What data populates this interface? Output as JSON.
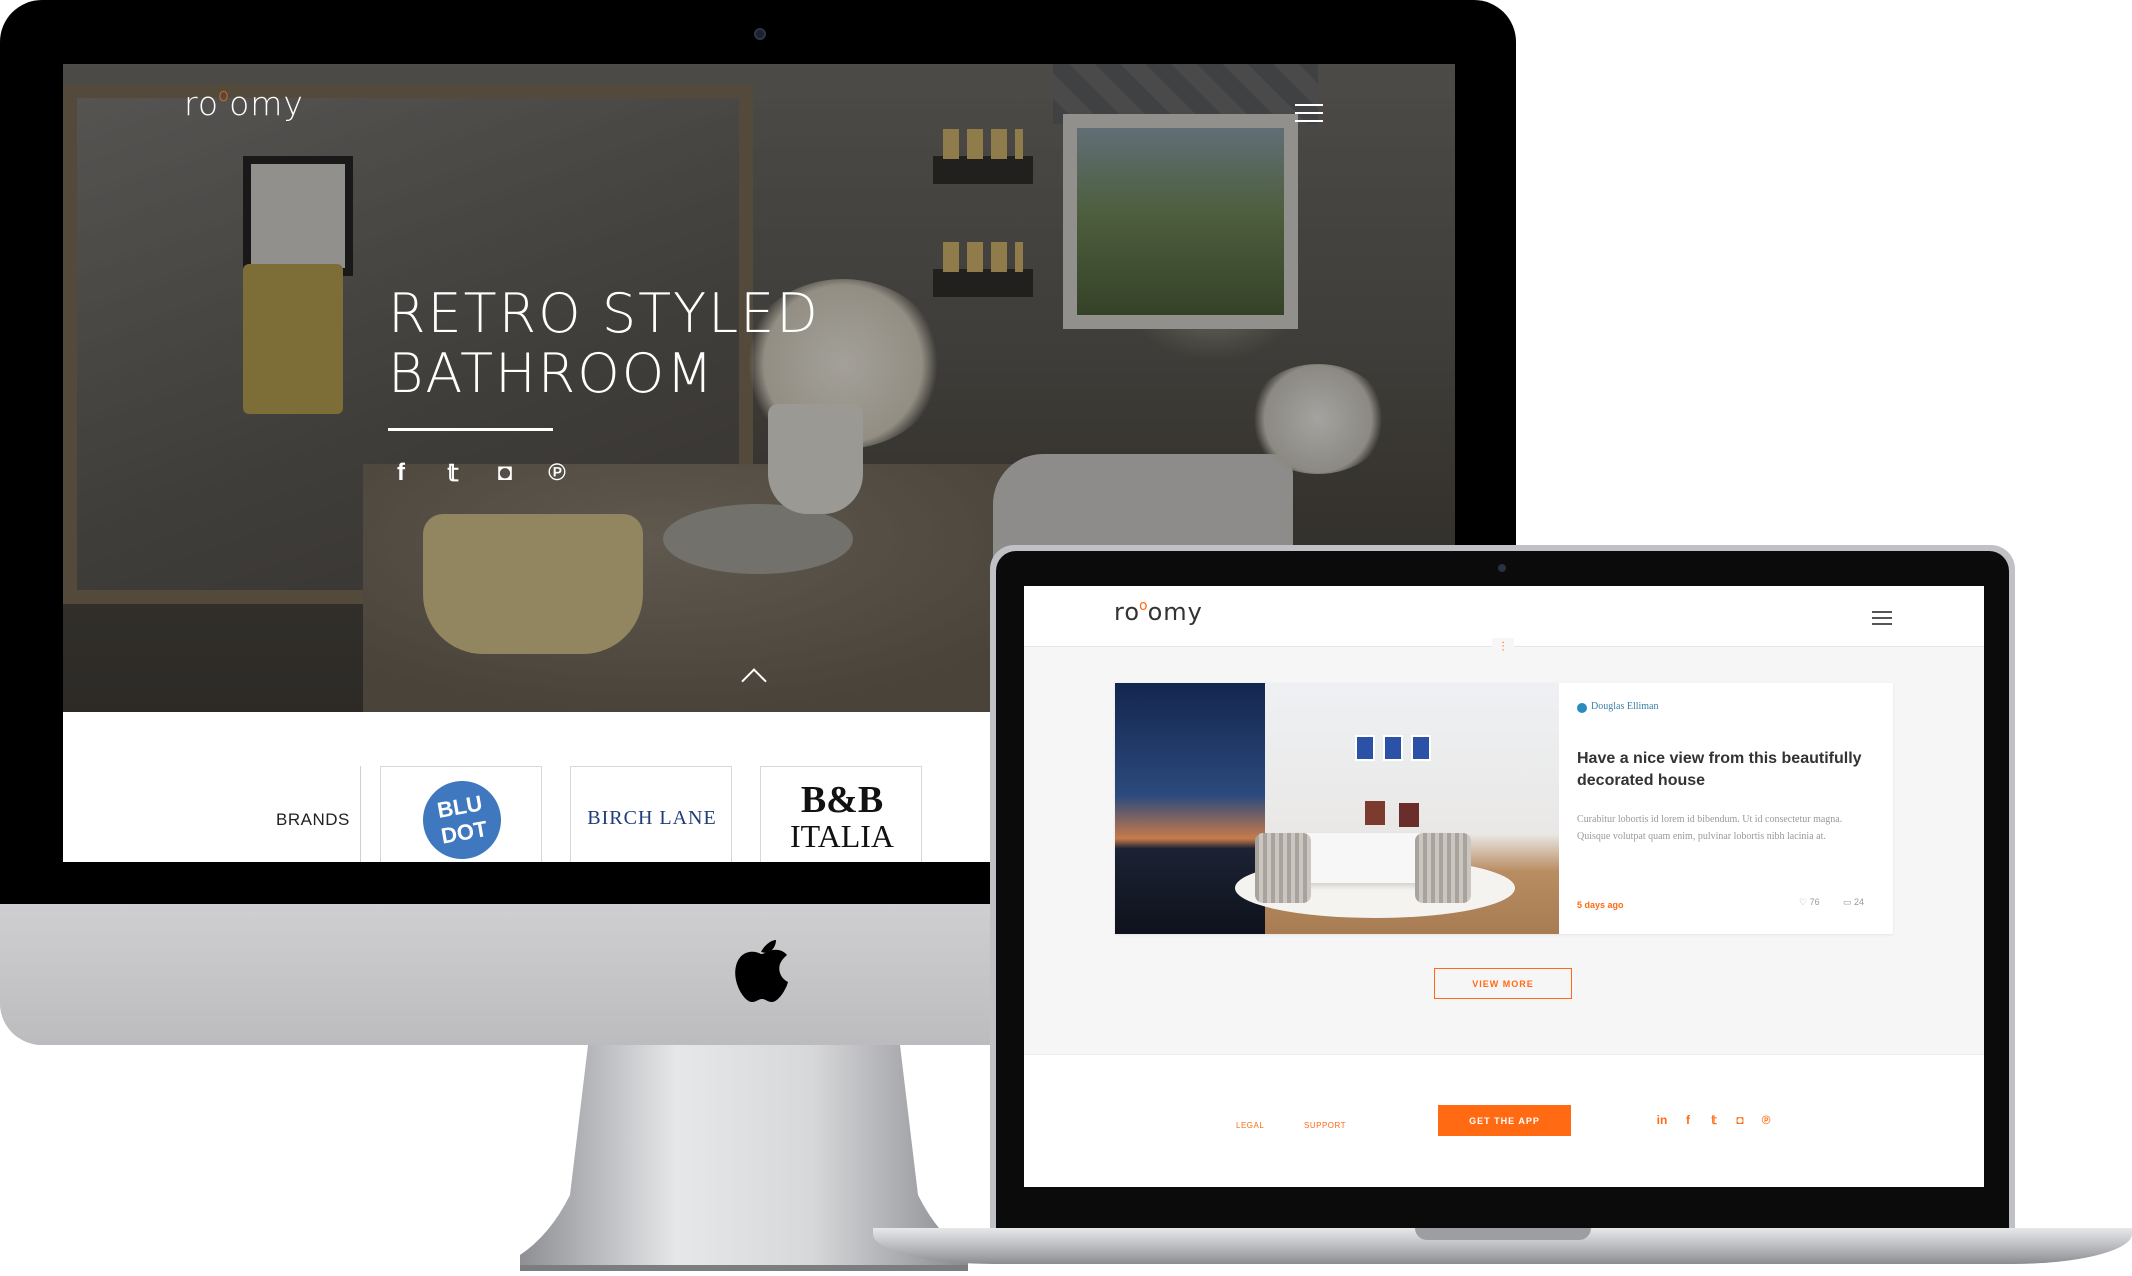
{
  "desktop": {
    "logo": {
      "text_before": "ro",
      "text_accent": "o",
      "text_after": "omy"
    },
    "hero": {
      "title_line1": "RETRO STYLED",
      "title_line2": "BATHROOM",
      "social_icons": [
        "facebook-icon",
        "twitter-icon",
        "instagram-icon",
        "pinterest-icon"
      ],
      "social_glyphs": [
        "f",
        "𝕥",
        "◘",
        "℗"
      ]
    },
    "brands": {
      "label": "BRANDS",
      "items": [
        {
          "name": "bludot",
          "line1": "BLU",
          "line2": "DOT",
          "color": "#3f78bf"
        },
        {
          "name": "birch-lane",
          "text": "BIRCH LANE",
          "color": "#1f3d7a"
        },
        {
          "name": "bb-italia",
          "line1": "B&B",
          "line2": "ITALIA",
          "color": "#111111"
        }
      ]
    }
  },
  "laptop": {
    "logo": {
      "text_before": "ro",
      "text_accent": "o",
      "text_after": "omy"
    },
    "filter_icon": "⫶",
    "card": {
      "brand": "Douglas Elliman",
      "title": "Have a nice view from this beautifully decorated house",
      "body": "Curabitur lobortis id lorem id bibendum. Ut id consectetur magna. Quisque volutpat quam enim, pulvinar lobortis nibh lacinia at.",
      "date": "5 days ago",
      "likes": "♡ 76",
      "comments": "▭ 24"
    },
    "view_more": "VIEW MORE",
    "footer": {
      "legal": "LEGAL",
      "support": "SUPPORT",
      "get_app": "GET THE APP",
      "social_glyphs": [
        "in",
        "f",
        "𝕥",
        "◘",
        "℗"
      ]
    }
  },
  "colors": {
    "accent": "#ff6a13",
    "bezel": "#000000",
    "aluminum": "#c9c9cc"
  }
}
